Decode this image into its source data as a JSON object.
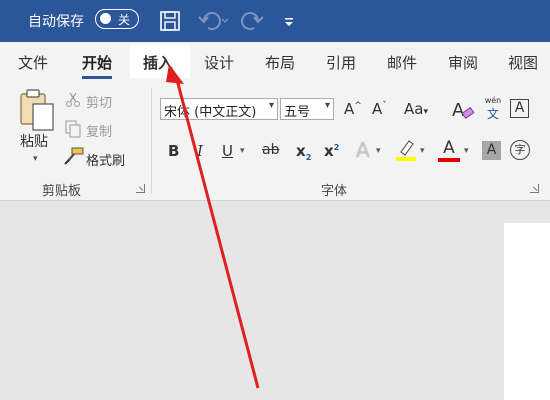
{
  "title_bar": {
    "autosave_label": "自动保存",
    "autosave_state": "关",
    "colors": {
      "background": "#2b579a",
      "text": "#ffffff"
    },
    "icons": [
      "save-icon",
      "undo-icon",
      "redo-icon",
      "customize-toolbar-icon"
    ]
  },
  "tabs": [
    {
      "label": "文件",
      "active": false
    },
    {
      "label": "开始",
      "active": true
    },
    {
      "label": "插入",
      "active": false,
      "hovered": true
    },
    {
      "label": "设计",
      "active": false
    },
    {
      "label": "布局",
      "active": false
    },
    {
      "label": "引用",
      "active": false
    },
    {
      "label": "邮件",
      "active": false
    },
    {
      "label": "审阅",
      "active": false
    },
    {
      "label": "视图",
      "active": false
    }
  ],
  "clipboard": {
    "paste_label": "粘贴",
    "cut_label": "剪切",
    "copy_label": "复制",
    "format_painter_label": "格式刷",
    "group_label": "剪贴板"
  },
  "font": {
    "font_name": "宋体 (中文正文)",
    "font_size": "五号",
    "change_case_glyph": "Aa",
    "phonetic_glyph": "wén",
    "phonetic_char": "文",
    "border_glyph": "A",
    "enclose_glyph": "字",
    "group_label": "字体",
    "highlight_color": "#ffff00",
    "font_color": "#e00000"
  },
  "annotation": {
    "arrow_color": "#e02020"
  }
}
